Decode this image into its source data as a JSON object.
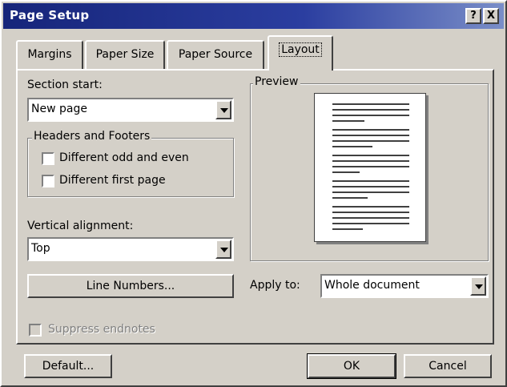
{
  "window": {
    "title": "Page Setup",
    "help_glyph": "?",
    "close_glyph": "X"
  },
  "tabs": [
    {
      "label": "Margins",
      "active": false
    },
    {
      "label": "Paper Size",
      "active": false
    },
    {
      "label": "Paper Source",
      "active": false
    },
    {
      "label": "Layout",
      "active": true
    }
  ],
  "layout": {
    "section_start": {
      "label": "Section start:",
      "value": "New page"
    },
    "headers_footers": {
      "title": "Headers and Footers",
      "odd_even": {
        "label": "Different odd and even",
        "checked": false
      },
      "first_page": {
        "label": "Different first page",
        "checked": false
      }
    },
    "vertical_alignment": {
      "label": "Vertical alignment:",
      "value": "Top"
    },
    "line_numbers_button": "Line Numbers...",
    "suppress_endnotes": {
      "label": "Suppress endnotes",
      "checked": false,
      "disabled": true
    },
    "preview": {
      "title": "Preview"
    },
    "apply_to": {
      "label": "Apply to:",
      "value": "Whole document"
    }
  },
  "footer": {
    "default_button": "Default...",
    "ok_button": "OK",
    "cancel_button": "Cancel"
  },
  "colors": {
    "dialog_bg": "#d4d0c8",
    "title_start": "#16257a",
    "title_end": "#7a8ec8"
  }
}
